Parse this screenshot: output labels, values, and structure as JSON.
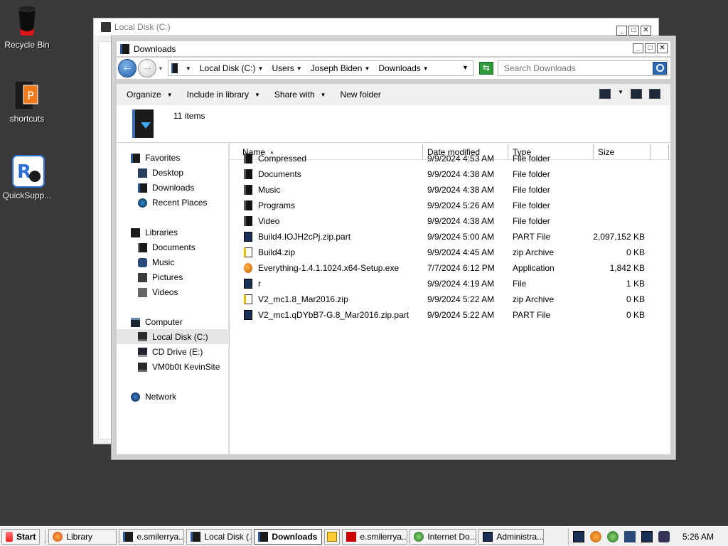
{
  "desktop": {
    "icons": [
      {
        "label": "Recycle Bin"
      },
      {
        "label": "shortcuts"
      },
      {
        "label": "QuickSupp..."
      }
    ]
  },
  "back_window": {
    "title": "Local Disk (C:)"
  },
  "window": {
    "title": "Downloads",
    "address": {
      "crumbs": [
        "Local Disk (C:)",
        "Users",
        "Joseph Biden",
        "Downloads"
      ]
    },
    "search_placeholder": "Search Downloads",
    "toolbar": {
      "organize": "Organize",
      "include_in_library": "Include in library",
      "share_with": "Share with",
      "new_folder": "New folder"
    },
    "item_count": "11 items",
    "nav": {
      "favorites": "Favorites",
      "desktop": "Desktop",
      "downloads": "Downloads",
      "recent_places": "Recent Places",
      "libraries": "Libraries",
      "documents": "Documents",
      "music": "Music",
      "pictures": "Pictures",
      "videos": "Videos",
      "computer": "Computer",
      "local_disk": "Local Disk (C:)",
      "cd_drive": "CD Drive (E:)",
      "vm_share": "VM0b0t KevinSite",
      "network": "Network"
    },
    "columns": {
      "name": "Name",
      "date": "Date modified",
      "type": "Type",
      "size": "Size"
    },
    "files": [
      {
        "name": "Compressed",
        "date": "9/9/2024 4:53 AM",
        "type": "File folder",
        "size": "",
        "icon": "folder"
      },
      {
        "name": "Documents",
        "date": "9/9/2024 4:38 AM",
        "type": "File folder",
        "size": "",
        "icon": "folder"
      },
      {
        "name": "Music",
        "date": "9/9/2024 4:38 AM",
        "type": "File folder",
        "size": "",
        "icon": "folder"
      },
      {
        "name": "Programs",
        "date": "9/9/2024 5:26 AM",
        "type": "File folder",
        "size": "",
        "icon": "folder"
      },
      {
        "name": "Video",
        "date": "9/9/2024 4:38 AM",
        "type": "File folder",
        "size": "",
        "icon": "folder"
      },
      {
        "name": "Build4.IOJH2cPj.zip.part",
        "date": "9/9/2024 5:00 AM",
        "type": "PART File",
        "size": "2,097,152 KB",
        "icon": "part"
      },
      {
        "name": "Build4.zip",
        "date": "9/9/2024 4:45 AM",
        "type": "zip Archive",
        "size": "0 KB",
        "icon": "zip"
      },
      {
        "name": "Everything-1.4.1.1024.x64-Setup.exe",
        "date": "7/7/2024 6:12 PM",
        "type": "Application",
        "size": "1,842 KB",
        "icon": "app"
      },
      {
        "name": "r",
        "date": "9/9/2024 4:19 AM",
        "type": "File",
        "size": "1 KB",
        "icon": "file"
      },
      {
        "name": "V2_mc1.8_Mar2016.zip",
        "date": "9/9/2024 5:22 AM",
        "type": "zip Archive",
        "size": "0 KB",
        "icon": "zip"
      },
      {
        "name": "V2_mc1.qDYbB7-G.8_Mar2016.zip.part",
        "date": "9/9/2024 5:22 AM",
        "type": "PART File",
        "size": "0 KB",
        "icon": "part"
      }
    ]
  },
  "taskbar": {
    "start": "Start",
    "buttons": [
      {
        "label": "Library",
        "icon": "firefox-icon"
      },
      {
        "label": "e.smilerrya...",
        "icon": "explorer-icon"
      },
      {
        "label": "Local Disk (...",
        "icon": "explorer-icon"
      },
      {
        "label": "Downloads",
        "icon": "explorer-icon"
      },
      {
        "label": "",
        "icon": "vlc-icon"
      },
      {
        "label": "e.smilerrya...",
        "icon": "filezilla-icon"
      },
      {
        "label": "Internet Do...",
        "icon": "ie-icon"
      },
      {
        "label": "Administra...",
        "icon": "cmd-icon"
      }
    ],
    "clock": "5:26 AM"
  }
}
